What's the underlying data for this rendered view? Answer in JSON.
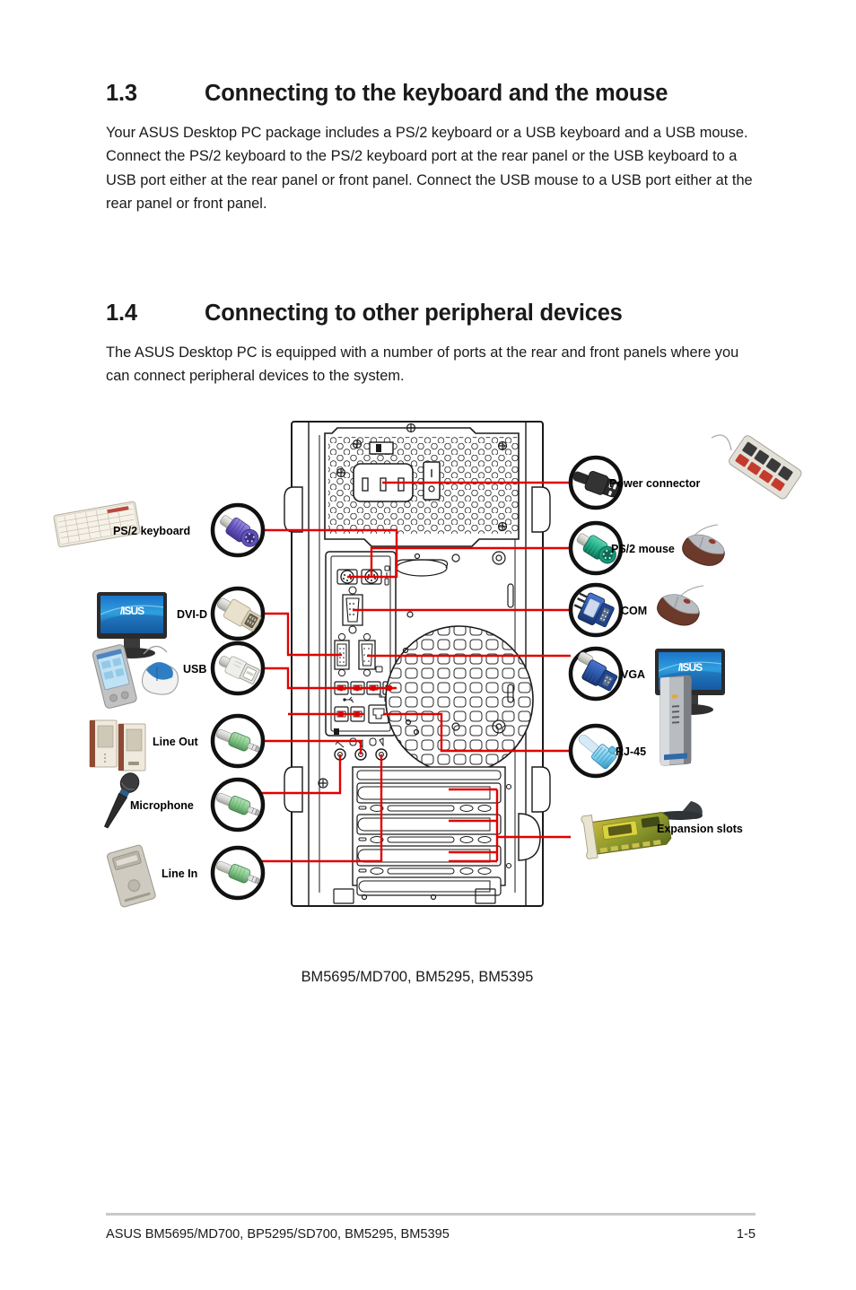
{
  "sections": [
    {
      "number": "1.3",
      "title": "Connecting to the keyboard and the mouse",
      "body": "Your ASUS Desktop PC package includes a PS/2 keyboard or a USB keyboard and a USB mouse. Connect the PS/2 keyboard to the PS/2 keyboard port at the rear panel or the USB keyboard to a USB port either at the rear panel or front panel. Connect the USB mouse to a USB port either at the rear panel or front panel."
    },
    {
      "number": "1.4",
      "title": "Connecting to other peripheral devices",
      "body": "The ASUS Desktop PC is equipped with a number of ports at the rear and front panels where you can connect peripheral devices to the system."
    }
  ],
  "diagram": {
    "caption": "BM5695/MD700, BM5295, BM5395",
    "left_labels": [
      {
        "id": "ps2-keyboard",
        "text": "PS/2 keyboard",
        "connector_color": "#6b59c4"
      },
      {
        "id": "dvi-d",
        "text": "DVI-D",
        "connector_color": "#e4ddc9"
      },
      {
        "id": "usb",
        "text": "USB",
        "connector_color": "#e6e6e6"
      },
      {
        "id": "line-out",
        "text": "Line Out",
        "connector_color": "#8fcf92"
      },
      {
        "id": "microphone",
        "text": "Microphone",
        "connector_color": "#8fcf92"
      },
      {
        "id": "line-in",
        "text": "Line In",
        "connector_color": "#8fcf92"
      }
    ],
    "right_labels": [
      {
        "id": "power-connector",
        "text": "Power connector",
        "connector_color": "#2b2b2b"
      },
      {
        "id": "ps2-mouse",
        "text": "PS/2 mouse",
        "connector_color": "#1faa84"
      },
      {
        "id": "com",
        "text": "COM",
        "connector_color": "#2a55a8"
      },
      {
        "id": "vga",
        "text": "VGA",
        "connector_color": "#2a55a8"
      },
      {
        "id": "rj-45",
        "text": "RJ-45",
        "connector_color": "#6fc6e8"
      },
      {
        "id": "expansion-slots",
        "text": "Expansion slots",
        "connector_color": "#b8a23a"
      }
    ],
    "leader_line_color": "#e10000",
    "chassis_outline_color": "#1a1a1a"
  },
  "footer": {
    "left": "ASUS BM5695/MD700, BP5295/SD700, BM5295, BM5395",
    "page": "1-5"
  }
}
